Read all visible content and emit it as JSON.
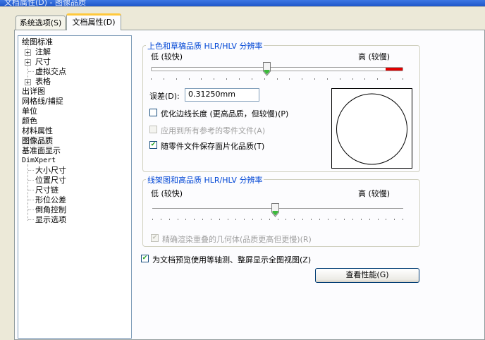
{
  "window": {
    "title": "文档属性(D) - 图像品质"
  },
  "tabs": [
    {
      "label": "系统选项(S)",
      "active": false
    },
    {
      "label": "文档属性(D)",
      "active": true
    }
  ],
  "tree": {
    "items": [
      {
        "label": "绘图标准",
        "level": 0,
        "expander": false
      },
      {
        "label": "注解",
        "level": 1,
        "expander": true
      },
      {
        "label": "尺寸",
        "level": 1,
        "expander": true
      },
      {
        "label": "虚拟交点",
        "level": 1,
        "expander": false
      },
      {
        "label": "表格",
        "level": 1,
        "expander": true
      },
      {
        "label": "出详图",
        "level": 0,
        "expander": false
      },
      {
        "label": "网格线/捕捉",
        "level": 0,
        "expander": false
      },
      {
        "label": "单位",
        "level": 0,
        "expander": false
      },
      {
        "label": "颜色",
        "level": 0,
        "expander": false
      },
      {
        "label": "材料属性",
        "level": 0,
        "expander": false
      },
      {
        "label": "图像品质",
        "level": 0,
        "expander": false,
        "selected": true
      },
      {
        "label": "基准面显示",
        "level": 0,
        "expander": false
      },
      {
        "label": "DimXpert",
        "level": 0,
        "expander": false
      },
      {
        "label": "大小尺寸",
        "level": 1,
        "expander": false
      },
      {
        "label": "位置尺寸",
        "level": 1,
        "expander": false
      },
      {
        "label": "尺寸链",
        "level": 1,
        "expander": false
      },
      {
        "label": "形位公差",
        "level": 1,
        "expander": false
      },
      {
        "label": "倒角控制",
        "level": 1,
        "expander": false
      },
      {
        "label": "显示选项",
        "level": 1,
        "expander": false
      }
    ]
  },
  "shaded": {
    "title": "上色和草稿品质 HLR/HLV 分辨率",
    "low_label": "低 (较快)",
    "high_label": "高 (较慢)",
    "slider_fraction": 0.46,
    "deviation_label": "误差(D):",
    "deviation_value": "0.31250mm",
    "optimize_edge": {
      "label": "优化边线长度 (更高品质，但较慢)(P)",
      "checked": false,
      "enabled": true
    },
    "apply_all": {
      "label": "应用到所有参考的零件文件(A)",
      "checked": false,
      "enabled": false
    },
    "save_tess": {
      "label": "随零件文件保存面片化品质(T)",
      "checked": true,
      "enabled": true
    },
    "high_color": "#e00000"
  },
  "wireframe": {
    "title": "线架图和高品质 HLR/HLV 分辨率",
    "low_label": "低 (较快)",
    "high_label": "高 (较慢)",
    "slider_fraction": 0.49,
    "precise": {
      "label": "精确渲染重叠的几何体(品质更高但更慢)(R)",
      "checked": true,
      "enabled": false
    }
  },
  "iso_preview": {
    "label": "为文档预览使用等轴测、整屏显示全图视图(Z)",
    "checked": true
  },
  "perf_button": {
    "label": "查看性能(G)"
  }
}
